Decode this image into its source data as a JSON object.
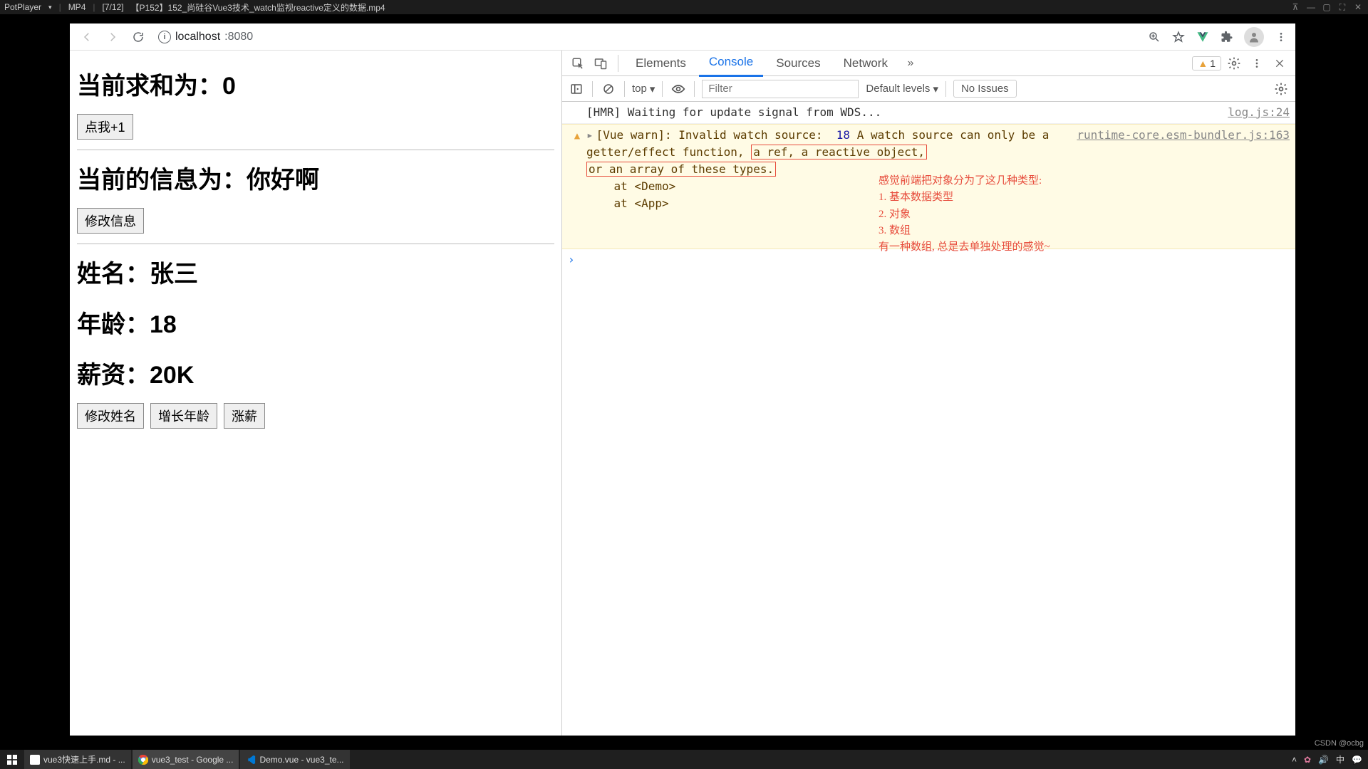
{
  "potplayer": {
    "app": "PotPlayer",
    "format": "MP4",
    "index": "[7/12]",
    "title": "【P152】152_尚硅谷Vue3技术_watch监视reactive定义的数据.mp4"
  },
  "chrome": {
    "url_host": "localhost",
    "url_port": ":8080"
  },
  "page": {
    "sum_label": "当前求和为：",
    "sum_value": "0",
    "btn_inc": "点我+1",
    "msg_label": "当前的信息为：",
    "msg_value": "你好啊",
    "btn_edit_msg": "修改信息",
    "name_label": "姓名：",
    "name_value": "张三",
    "age_label": "年龄：",
    "age_value": "18",
    "salary_label": "薪资：",
    "salary_value": "20K",
    "btn_edit_name": "修改姓名",
    "btn_inc_age": "增长年龄",
    "btn_raise": "涨薪"
  },
  "devtools": {
    "tabs": {
      "elements": "Elements",
      "console": "Console",
      "sources": "Sources",
      "network": "Network"
    },
    "warn_count": "1",
    "filter": {
      "context": "top",
      "placeholder": "Filter",
      "levels": "Default levels",
      "issues": "No Issues"
    },
    "log": {
      "hmr": "[HMR] Waiting for update signal from WDS...",
      "hmr_link": "log.js:24",
      "warn_prefix": "[Vue warn]: Invalid watch source:  ",
      "warn_value": "18",
      "warn_mid": " A watch source can only be a getter/effect function, ",
      "warn_hl1": "a ref, a reactive object,",
      "warn_hl2": "or an array of these types.",
      "warn_at1": "    at <Demo>",
      "warn_at2": "    at <App>",
      "warn_link": "runtime-core.esm-bundler.js:163"
    },
    "prompt": "›",
    "annotation": {
      "l1": "感觉前端把对象分为了这几种类型:",
      "l2": "1. 基本数据类型",
      "l3": "2. 对象",
      "l4": "3. 数组",
      "l5": "有一种数组, 总是去单独处理的感觉~"
    }
  },
  "taskbar": {
    "items": [
      {
        "label": "vue3快速上手.md - ..."
      },
      {
        "label": "vue3_test - Google ..."
      },
      {
        "label": "Demo.vue - vue3_te..."
      }
    ],
    "ime": "中"
  },
  "watermark": "CSDN @ocbg"
}
